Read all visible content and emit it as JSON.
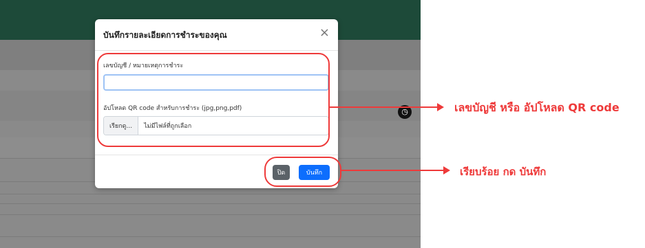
{
  "background": {
    "clock_icon": "clock-icon"
  },
  "modal": {
    "title": "บันทึกรายละเอียดการชำระของคุณ",
    "close_icon": "×",
    "account_label": "เลขบัญชี / หมายเหตุการชำระ",
    "account_value": "",
    "upload_label": "อัปโหลด QR code สำหรับการชำระ (jpg,png,pdf)",
    "browse_label": "เรียกดู...",
    "no_file_text": "ไม่มีไฟล์ที่ถูกเลือก",
    "close_button": "ปิด",
    "save_button": "บันทึก"
  },
  "annotations": {
    "form_note": "เลขบัญชี หรือ อัปโหลด QR code",
    "button_note": "เรียบร้อย กด บันทึก",
    "color": "#ee3a3a"
  },
  "colors": {
    "header_green": "#1d4a39",
    "primary": "#0d6efd",
    "secondary": "#5b6268"
  }
}
